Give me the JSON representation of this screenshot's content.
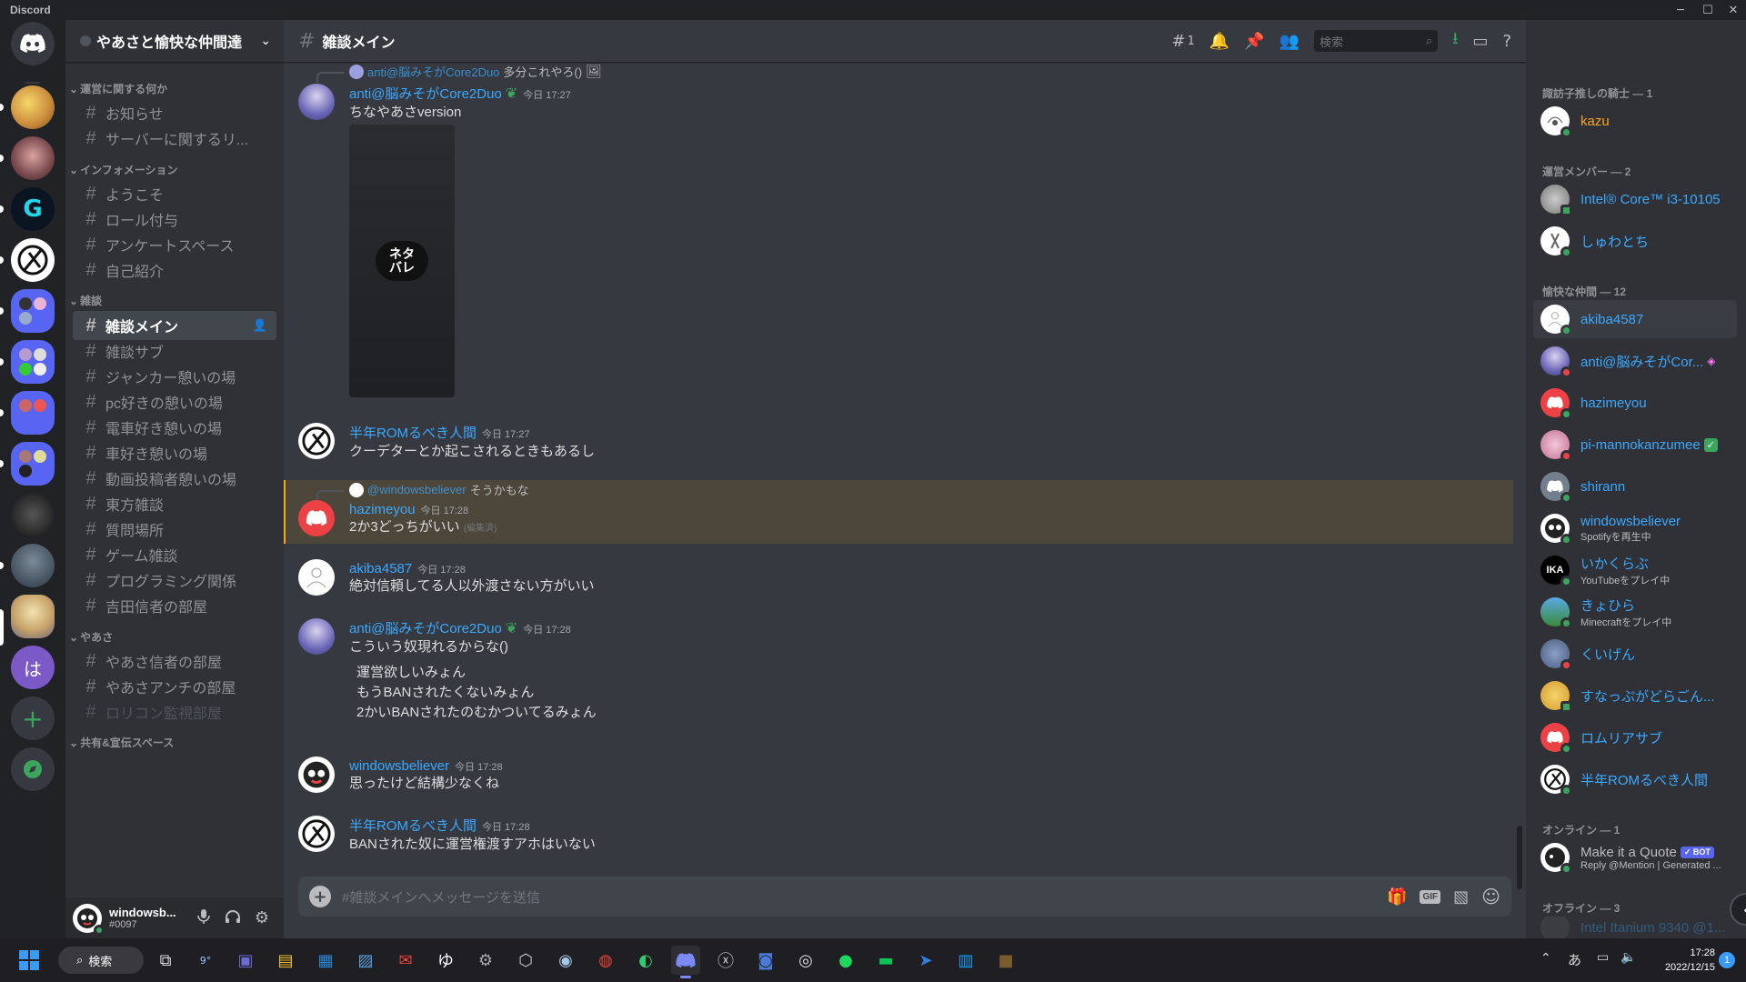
{
  "window": {
    "title": "Discord"
  },
  "server": {
    "name": "やあさと愉快な仲間達"
  },
  "categories": [
    "運営に関する何か",
    "インフォメーション",
    "雑談",
    "やあさ",
    "共有&宣伝スペース"
  ],
  "channels": {
    "c0": "お知らせ",
    "c1": "サーバーに関するリ...",
    "c2": "ようこそ",
    "c3": "ロール付与",
    "c4": "アンケートスペース",
    "c5": "自己紹介",
    "c6": "雑談メイン",
    "c7": "雑談サブ",
    "c8": "ジャンカー憩いの場",
    "c9": "pc好きの憩いの場",
    "c10": "電車好き憩いの場",
    "c11": "車好き憩いの場",
    "c12": "動画投稿者憩いの場",
    "c13": "東方雑談",
    "c14": "質問場所",
    "c15": "ゲーム雑談",
    "c16": "プログラミング関係",
    "c17": "吉田信者の部屋",
    "c18": "やあさ信者の部屋",
    "c19": "やあさアンチの部屋",
    "c20": "ロリコン監視部屋"
  },
  "user": {
    "name": "windowsb...",
    "tag": "#0097"
  },
  "header": {
    "channel": "雑談メイン",
    "thread_count": "1",
    "search_placeholder": "検索"
  },
  "messages": {
    "m1": {
      "reply_user": "anti@脳みそがCore2Duo",
      "reply_text": "多分これやろ()",
      "author": "anti@脳みそがCore2Duo",
      "time": "今日 17:27",
      "text": "ちなやあさversion",
      "spoiler": "ネタバレ"
    },
    "m2": {
      "author": "半年ROMるべき人間",
      "time": "今日 17:27",
      "text": "クーデターとか起こされるときもあるし"
    },
    "m3": {
      "reply_user": "@windowsbeliever",
      "reply_text": "そうかもな",
      "author": "hazimeyou",
      "time": "今日 17:28",
      "text": "2か3どっちがいい",
      "edited": "(編集済)"
    },
    "m4": {
      "author": "akiba4587",
      "time": "今日 17:28",
      "text": "絶対信頼してる人以外渡さない方がいい"
    },
    "m5": {
      "author": "anti@脳みそがCore2Duo",
      "time": "今日 17:28",
      "text": "こういう奴現れるからな()",
      "quote1": "運営欲しいみょん",
      "quote2": "もうBANされたくないみょん",
      "quote3": "2かいBANされたのむかついてるみょん"
    },
    "m6": {
      "author": "windowsbeliever",
      "time": "今日 17:28",
      "text": "思ったけど結構少なくね"
    },
    "m7": {
      "author": "半年ROMるべき人間",
      "time": "今日 17:28",
      "text": "BANされた奴に運営権渡すアホはいない"
    }
  },
  "composer": {
    "placeholder": "#雑談メインへメッセージを送信",
    "gif": "GIF"
  },
  "member_groups": {
    "g1": "諏訪子推しの騎士 — 1",
    "g2": "運営メンバー — 2",
    "g3": "愉快な仲間 — 12",
    "g4": "オンライン — 1",
    "g5": "オフライン — 3"
  },
  "members": {
    "u1": {
      "name": "kazu",
      "color": "#faa61a"
    },
    "u2": {
      "name": "Intel® Core™ i3-10105"
    },
    "u3": {
      "name": "しゅわとち"
    },
    "u4": {
      "name": "akiba4587"
    },
    "u5": {
      "name": "anti@脳みそがCor..."
    },
    "u6": {
      "name": "hazimeyou"
    },
    "u7": {
      "name": "pi-mannokanzumee"
    },
    "u8": {
      "name": "shirann"
    },
    "u9": {
      "name": "windowsbeliever",
      "activity": "Spotifyを再生中"
    },
    "u10": {
      "name": "いかくらぶ",
      "activity": "YouTubeをプレイ中"
    },
    "u11": {
      "name": "きょひら",
      "activity": "Minecraftをプレイ中"
    },
    "u12": {
      "name": "くいげん"
    },
    "u13": {
      "name": "すなっぷがどらごん..."
    },
    "u14": {
      "name": "ロムリアサブ"
    },
    "u15": {
      "name": "半年ROMるべき人間"
    },
    "u16": {
      "name": "Make it a Quote",
      "activity": "Reply @Mention | Generated ...",
      "badge": "✓ BOT"
    },
    "u17": {
      "name": "Intel Itanium 9340 @1..."
    }
  },
  "server_icon_label": "は",
  "taskbar": {
    "search": "検索",
    "time": "17:28",
    "date": "2022/12/15",
    "ime": "あ",
    "notif": "1",
    "weather": "9°"
  },
  "colors": {
    "accent": "#5865f2",
    "online": "#3ba55d",
    "dnd": "#ed4245",
    "idle": "#faa61a",
    "link": "#3ba9ff",
    "highlight": "#faa61a"
  }
}
